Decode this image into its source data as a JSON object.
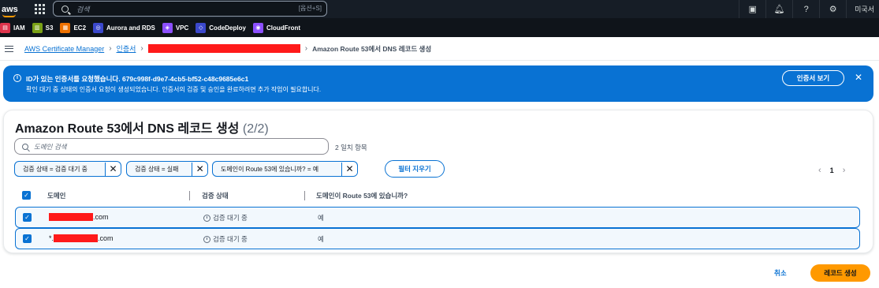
{
  "topnav": {
    "logo_text": "aws",
    "search_placeholder": "검색",
    "search_shortcut": "[옵션+S]",
    "region_label": "미국서"
  },
  "favorites": [
    {
      "label": "IAM",
      "color": "#dd344c",
      "icon": "iam-icon"
    },
    {
      "label": "S3",
      "color": "#7aa116",
      "icon": "s3-icon"
    },
    {
      "label": "EC2",
      "color": "#ed7100",
      "icon": "ec2-icon"
    },
    {
      "label": "Aurora and RDS",
      "color": "#3b48cc",
      "icon": "rds-icon"
    },
    {
      "label": "VPC",
      "color": "#8c4fff",
      "icon": "vpc-icon"
    },
    {
      "label": "CodeDeploy",
      "color": "#3b48cc",
      "icon": "codedeploy-icon"
    },
    {
      "label": "CloudFront",
      "color": "#8c4fff",
      "icon": "cloudfront-icon"
    }
  ],
  "breadcrumb": {
    "service": "AWS Certificate Manager",
    "certificates": "인증서",
    "current": "Amazon Route 53에서 DNS 레코드 생성"
  },
  "flash": {
    "title": "ID가 있는 인증서를 요청했습니다. 679c998f-d9e7-4cb5-bf52-c48c9685e6c1",
    "message": "확인 대기 중 상태의 인증서 요청이 생성되었습니다. 인증서의 검증 및 승인을 완료하려면 추가 작업이 필요합니다.",
    "view_button": "인증서 보기",
    "close_glyph": "✕"
  },
  "panel": {
    "title": "Amazon Route 53에서 DNS 레코드 생성",
    "count": "(2/2)",
    "filter_placeholder": "도메인 검색",
    "matches": "2 일치 항목",
    "tokens": [
      "검증 상태 = 검증 대기 중",
      "검증 상태 = 실패",
      "도메인이 Route 53에 있습니까? = 예"
    ],
    "clear_filters": "필터 지우기",
    "page": "1",
    "columns": [
      "도메인",
      "검증 상태",
      "도메인이 Route 53에 있습니까?"
    ],
    "rows": [
      {
        "domain_prefix": "",
        "domain_suffix": ".com",
        "status": "검증 대기 중",
        "in_route53": "예"
      },
      {
        "domain_prefix": "*.",
        "domain_suffix": ".com",
        "status": "검증 대기 중",
        "in_route53": "예"
      }
    ]
  },
  "actions": {
    "cancel": "취소",
    "create": "레코드 생성"
  }
}
